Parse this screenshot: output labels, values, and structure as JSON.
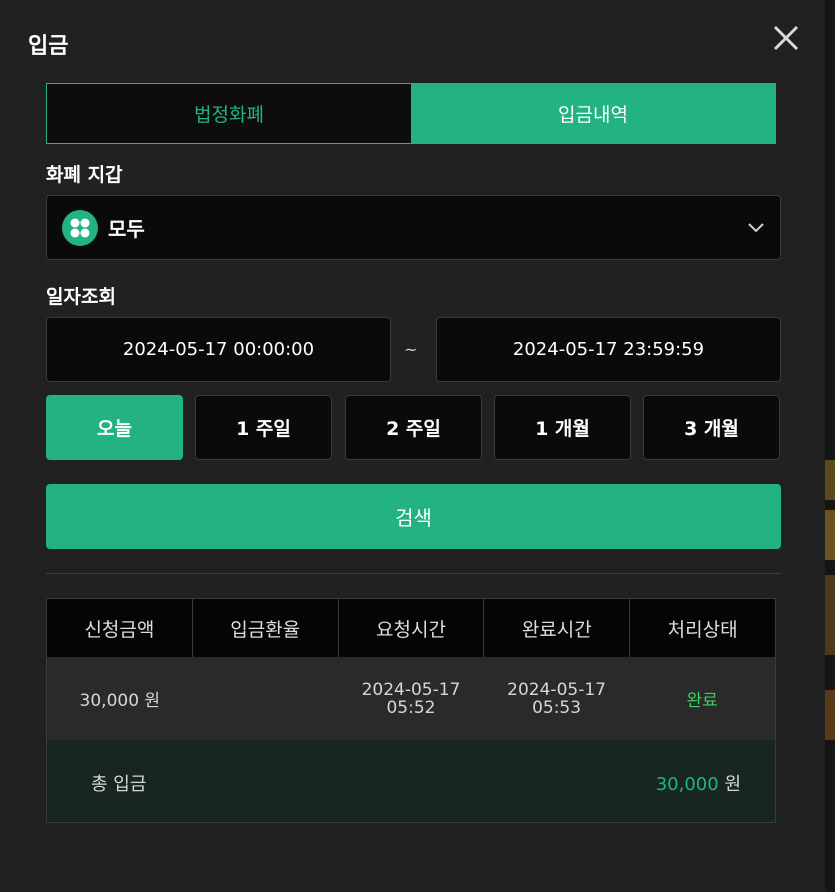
{
  "modal": {
    "title": "입금"
  },
  "tabs": [
    {
      "label": "법정화폐",
      "active": false
    },
    {
      "label": "입금내역",
      "active": true
    }
  ],
  "wallet": {
    "label": "화폐 지갑",
    "selected": "모두",
    "icon": "grid-coin-icon"
  },
  "date_query": {
    "label": "일자조회",
    "start": "2024-05-17 00:00:00",
    "separator": "~",
    "end": "2024-05-17 23:59:59"
  },
  "ranges": [
    {
      "label": "오늘",
      "active": true
    },
    {
      "label": "1 주일",
      "active": false
    },
    {
      "label": "2 주일",
      "active": false
    },
    {
      "label": "1 개월",
      "active": false
    },
    {
      "label": "3 개월",
      "active": false
    }
  ],
  "search_label": "검색",
  "table": {
    "headers": [
      "신청금액",
      "입금환율",
      "요청시간",
      "완료시간",
      "처리상태"
    ],
    "rows": [
      {
        "amount": "30,000 원",
        "rate": "",
        "request_date": "2024-05-17",
        "request_time": "05:52",
        "complete_date": "2024-05-17",
        "complete_time": "05:53",
        "status": "완료"
      }
    ],
    "total_label": "총 입금",
    "total_amount": "30,000",
    "total_unit": "원"
  },
  "colors": {
    "accent": "#22b283",
    "status_done": "#3cd05a",
    "background": "#212121"
  }
}
